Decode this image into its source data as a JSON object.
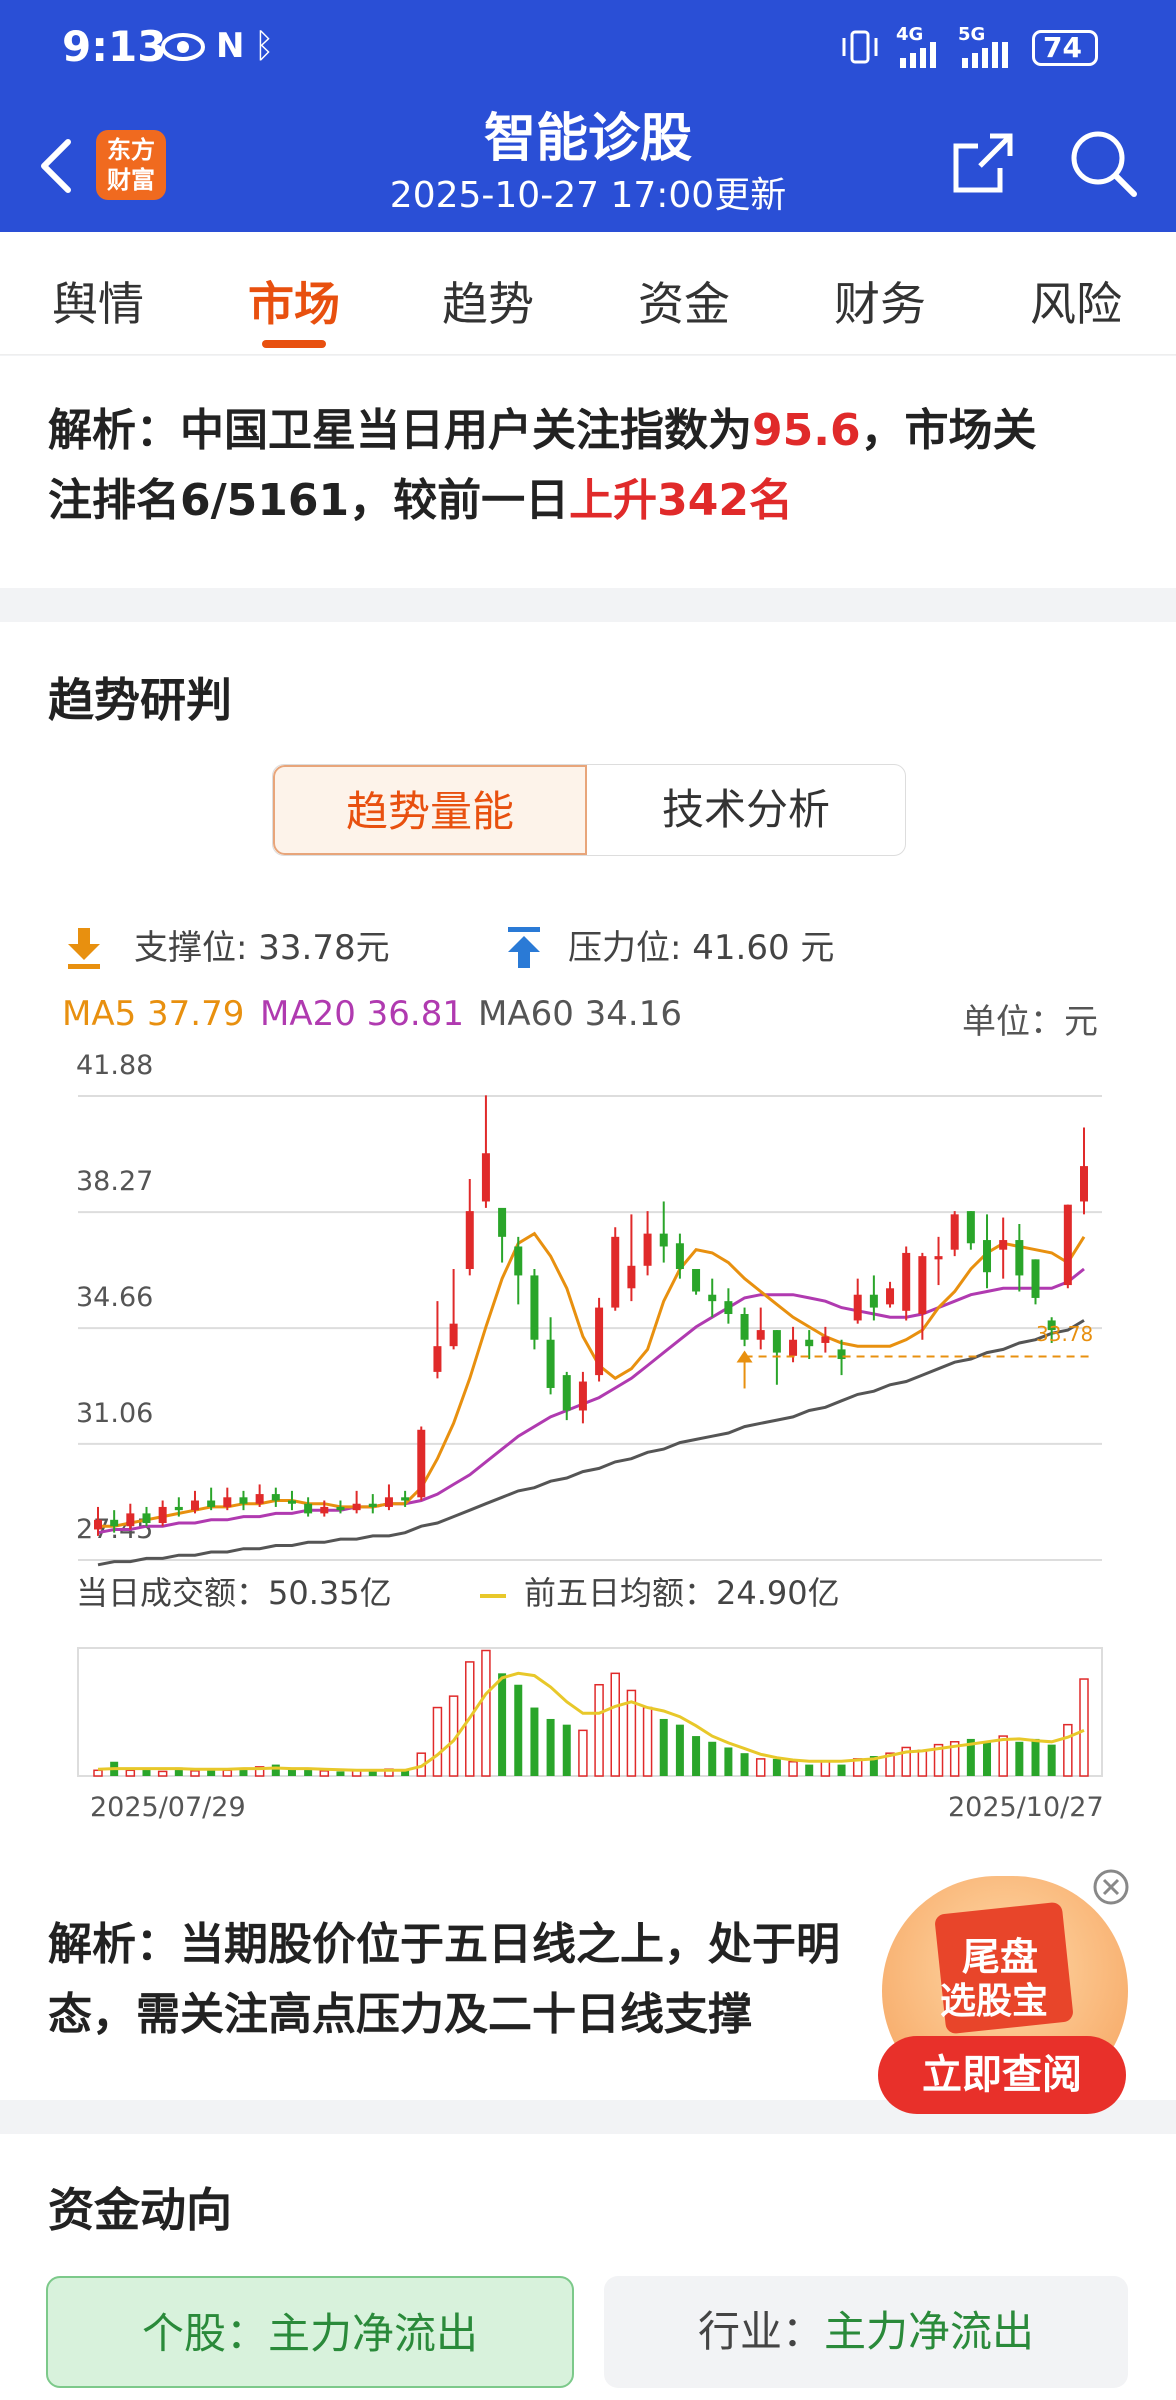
{
  "status_bar": {
    "time": "9:13",
    "battery": "74",
    "net1": "4G",
    "net2": "5G"
  },
  "app_bar": {
    "logo_text_line1": "东方",
    "logo_text_line2": "财富",
    "title": "智能诊股",
    "subtitle": "2025-10-27 17:00更新"
  },
  "tabs": [
    {
      "label": "舆情",
      "active": false
    },
    {
      "label": "市场",
      "active": true
    },
    {
      "label": "趋势",
      "active": false
    },
    {
      "label": "资金",
      "active": false
    },
    {
      "label": "财务",
      "active": false
    },
    {
      "label": "风险",
      "active": false
    }
  ],
  "analysis_top": {
    "prefix": "解析：中国卫星当日用户关注指数为",
    "index_value": "95.6",
    "mid": "，市场关",
    "line2_prefix": "注排名6/5161，较前一日",
    "rank_change": "上升342名"
  },
  "trend_section": {
    "title": "趋势研判",
    "segments": {
      "active": "趋势量能",
      "inactive": "技术分析"
    },
    "support": "支撑位: 33.78元",
    "resistance": "压力位: 41.60 元",
    "ma5": "MA5 37.79",
    "ma20": "MA20 36.81",
    "ma60": "MA60 34.16",
    "unit": "单位：元",
    "y_ticks": [
      "41.88",
      "38.27",
      "34.66",
      "31.06",
      "27.45"
    ],
    "support_marker": "33.78",
    "volume_label": "当日成交额：50.35亿",
    "avg_label": "前五日均额：24.90亿",
    "date_start": "2025/07/29",
    "date_end": "2025/10/27",
    "analysis_line1": "解析：当期股价位于五日线之上，处于明",
    "analysis_line2": "态，需关注高点压力及二十日线支撑"
  },
  "promo": {
    "line1": "尾盘",
    "line2": "选股宝",
    "button": "立即查阅"
  },
  "fund_section": {
    "title": "资金动向",
    "stock_label": "个股：",
    "stock_value": "主力净流出",
    "industry_label": "行业：",
    "industry_value": "主力净流出"
  },
  "colors": {
    "brand": "#2a4fd6",
    "accent": "#e8500f",
    "up": "#e02a2a",
    "down": "#2aa52a",
    "ma5": "#e8900f",
    "ma20": "#b03ab0",
    "ma60": "#555555",
    "vol_avg": "#e8c82a"
  },
  "chart_data": {
    "type": "candlestick",
    "x_range": [
      "2025/07/29",
      "2025/10/27"
    ],
    "ylim": [
      27.45,
      41.88
    ],
    "y_ticks": [
      41.88,
      38.27,
      34.66,
      31.06,
      27.45
    ],
    "candles": [
      [
        28.4,
        28.7,
        28.2,
        29.1
      ],
      [
        28.7,
        28.5,
        28.3,
        29.0
      ],
      [
        28.5,
        28.9,
        28.4,
        29.2
      ],
      [
        28.9,
        28.6,
        28.5,
        29.1
      ],
      [
        28.6,
        29.1,
        28.5,
        29.3
      ],
      [
        29.1,
        29.0,
        28.8,
        29.4
      ],
      [
        29.0,
        29.3,
        28.9,
        29.6
      ],
      [
        29.3,
        29.1,
        29.0,
        29.7
      ],
      [
        29.1,
        29.4,
        29.0,
        29.7
      ],
      [
        29.4,
        29.2,
        29.0,
        29.6
      ],
      [
        29.2,
        29.5,
        29.1,
        29.8
      ],
      [
        29.5,
        29.3,
        29.1,
        29.7
      ],
      [
        29.3,
        29.2,
        29.0,
        29.6
      ],
      [
        29.2,
        28.9,
        28.8,
        29.4
      ],
      [
        28.9,
        29.1,
        28.8,
        29.3
      ],
      [
        29.1,
        29.0,
        28.9,
        29.3
      ],
      [
        29.0,
        29.2,
        28.9,
        29.6
      ],
      [
        29.2,
        29.1,
        28.9,
        29.5
      ],
      [
        29.1,
        29.4,
        29.0,
        29.8
      ],
      [
        29.4,
        29.3,
        29.1,
        29.6
      ],
      [
        29.4,
        31.5,
        29.3,
        31.6
      ],
      [
        33.3,
        34.1,
        33.1,
        35.5
      ],
      [
        34.1,
        34.8,
        34.0,
        36.5
      ],
      [
        36.5,
        38.3,
        36.3,
        39.3
      ],
      [
        38.6,
        40.1,
        38.4,
        41.9
      ],
      [
        38.4,
        37.5,
        36.7,
        38.3
      ],
      [
        37.2,
        36.3,
        35.4,
        37.5
      ],
      [
        36.3,
        34.3,
        34.0,
        36.5
      ],
      [
        34.3,
        32.8,
        32.6,
        35.0
      ],
      [
        33.2,
        32.1,
        31.8,
        33.3
      ],
      [
        32.1,
        33.0,
        31.7,
        33.3
      ],
      [
        33.2,
        35.3,
        33.0,
        35.6
      ],
      [
        35.3,
        37.5,
        35.2,
        37.8
      ],
      [
        35.9,
        36.6,
        35.5,
        38.2
      ],
      [
        36.6,
        37.6,
        36.3,
        38.3
      ],
      [
        37.6,
        37.2,
        36.7,
        38.6
      ],
      [
        37.3,
        36.5,
        36.2,
        37.6
      ],
      [
        36.5,
        35.8,
        35.7,
        36.5
      ],
      [
        35.7,
        35.5,
        35.0,
        36.2
      ],
      [
        35.5,
        35.1,
        34.8,
        35.9
      ],
      [
        35.1,
        34.3,
        34.1,
        35.3
      ],
      [
        34.3,
        34.6,
        34.0,
        35.3
      ],
      [
        34.6,
        33.9,
        32.9,
        34.6
      ],
      [
        33.8,
        34.3,
        33.6,
        34.7
      ],
      [
        34.3,
        34.1,
        33.7,
        34.6
      ],
      [
        34.2,
        34.4,
        33.9,
        34.7
      ],
      [
        34.0,
        33.7,
        33.2,
        34.3
      ],
      [
        34.9,
        35.7,
        34.8,
        36.2
      ],
      [
        35.7,
        35.3,
        34.9,
        36.3
      ],
      [
        35.4,
        35.9,
        35.3,
        36.1
      ],
      [
        35.2,
        37.0,
        34.9,
        37.2
      ],
      [
        35.1,
        36.9,
        34.3,
        37.0
      ],
      [
        36.8,
        36.9,
        36.0,
        37.5
      ],
      [
        37.1,
        38.2,
        36.9,
        38.3
      ],
      [
        38.3,
        37.3,
        37.1,
        38.3
      ],
      [
        37.4,
        36.4,
        35.9,
        38.2
      ],
      [
        37.1,
        37.4,
        36.2,
        38.1
      ],
      [
        37.4,
        36.3,
        35.8,
        37.9
      ],
      [
        36.8,
        35.6,
        35.4,
        36.8
      ],
      [
        34.9,
        34.6,
        34.2,
        35.0
      ],
      [
        36.0,
        38.5,
        35.9,
        38.5
      ],
      [
        38.6,
        39.7,
        38.2,
        40.9
      ]
    ],
    "ma5": [
      28.5,
      28.5,
      28.6,
      28.7,
      28.8,
      28.9,
      29.0,
      29.1,
      29.1,
      29.2,
      29.2,
      29.3,
      29.3,
      29.2,
      29.2,
      29.1,
      29.1,
      29.1,
      29.2,
      29.2,
      29.7,
      30.6,
      31.7,
      33.1,
      34.7,
      36.2,
      37.3,
      37.6,
      36.9,
      35.9,
      34.4,
      33.5,
      33.1,
      33.4,
      34.0,
      35.5,
      36.5,
      37.1,
      37.0,
      36.7,
      36.2,
      35.8,
      35.4,
      35.0,
      34.7,
      34.4,
      34.2,
      34.1,
      34.1,
      34.1,
      34.3,
      34.6,
      35.3,
      35.8,
      36.5,
      37.0,
      37.3,
      37.2,
      37.1,
      37.0,
      36.7,
      37.5
    ],
    "ma20": [
      28.3,
      28.4,
      28.4,
      28.5,
      28.5,
      28.6,
      28.6,
      28.7,
      28.7,
      28.8,
      28.8,
      28.9,
      28.9,
      29.0,
      29.0,
      29.0,
      29.1,
      29.1,
      29.2,
      29.2,
      29.3,
      29.5,
      29.8,
      30.1,
      30.5,
      30.9,
      31.3,
      31.6,
      31.9,
      32.1,
      32.3,
      32.5,
      32.8,
      33.1,
      33.5,
      33.9,
      34.3,
      34.7,
      35.0,
      35.3,
      35.6,
      35.7,
      35.7,
      35.7,
      35.6,
      35.5,
      35.3,
      35.2,
      35.1,
      35.0,
      35.0,
      35.1,
      35.3,
      35.5,
      35.7,
      35.8,
      35.9,
      35.9,
      35.9,
      35.9,
      36.1,
      36.5
    ],
    "ma60": [
      27.3,
      27.4,
      27.4,
      27.5,
      27.5,
      27.6,
      27.6,
      27.7,
      27.7,
      27.8,
      27.8,
      27.9,
      27.9,
      28.0,
      28.0,
      28.1,
      28.1,
      28.2,
      28.2,
      28.3,
      28.5,
      28.6,
      28.8,
      29.0,
      29.2,
      29.4,
      29.6,
      29.7,
      29.9,
      30.0,
      30.2,
      30.3,
      30.5,
      30.6,
      30.8,
      30.9,
      31.1,
      31.2,
      31.3,
      31.4,
      31.6,
      31.7,
      31.8,
      31.9,
      32.1,
      32.2,
      32.4,
      32.6,
      32.7,
      32.9,
      33.0,
      33.2,
      33.4,
      33.6,
      33.7,
      33.9,
      34.0,
      34.2,
      34.3,
      34.5,
      34.6,
      34.9
    ],
    "support_level": 33.78,
    "volume": {
      "unit": "亿",
      "values": [
        1.0,
        2.5,
        1.0,
        1.2,
        0.8,
        1.5,
        0.9,
        1.3,
        1.0,
        1.4,
        1.6,
        2.0,
        1.1,
        1.2,
        0.9,
        0.8,
        1.0,
        0.9,
        1.2,
        1.1,
        4.0,
        12.0,
        14.0,
        20.0,
        22.0,
        18.0,
        16.0,
        12.0,
        10.0,
        9.0,
        8.0,
        16.0,
        18.0,
        15.0,
        12.0,
        10.0,
        9.0,
        7.0,
        6.0,
        5.0,
        4.0,
        3.0,
        3.0,
        2.5,
        2.0,
        2.5,
        2.0,
        3.0,
        3.5,
        4.0,
        5.0,
        4.5,
        5.5,
        6.0,
        6.5,
        6.0,
        7.0,
        6.0,
        6.5,
        5.5,
        9.0,
        17.0
      ],
      "avg5": [
        1.2,
        1.3,
        1.3,
        1.3,
        1.3,
        1.3,
        1.2,
        1.2,
        1.2,
        1.3,
        1.3,
        1.4,
        1.3,
        1.3,
        1.2,
        1.1,
        1.0,
        1.0,
        1.0,
        1.0,
        1.7,
        3.7,
        6.2,
        10.2,
        14.4,
        17.2,
        18.0,
        17.6,
        15.6,
        13.0,
        11.0,
        11.0,
        12.2,
        13.0,
        12.0,
        11.4,
        10.4,
        8.8,
        7.0,
        5.8,
        4.8,
        3.8,
        3.2,
        2.8,
        2.6,
        2.6,
        2.6,
        2.8,
        3.0,
        3.6,
        4.2,
        4.4,
        4.8,
        5.2,
        5.6,
        6.0,
        6.4,
        6.5,
        6.2,
        6.0,
        6.8,
        8.0
      ]
    }
  }
}
